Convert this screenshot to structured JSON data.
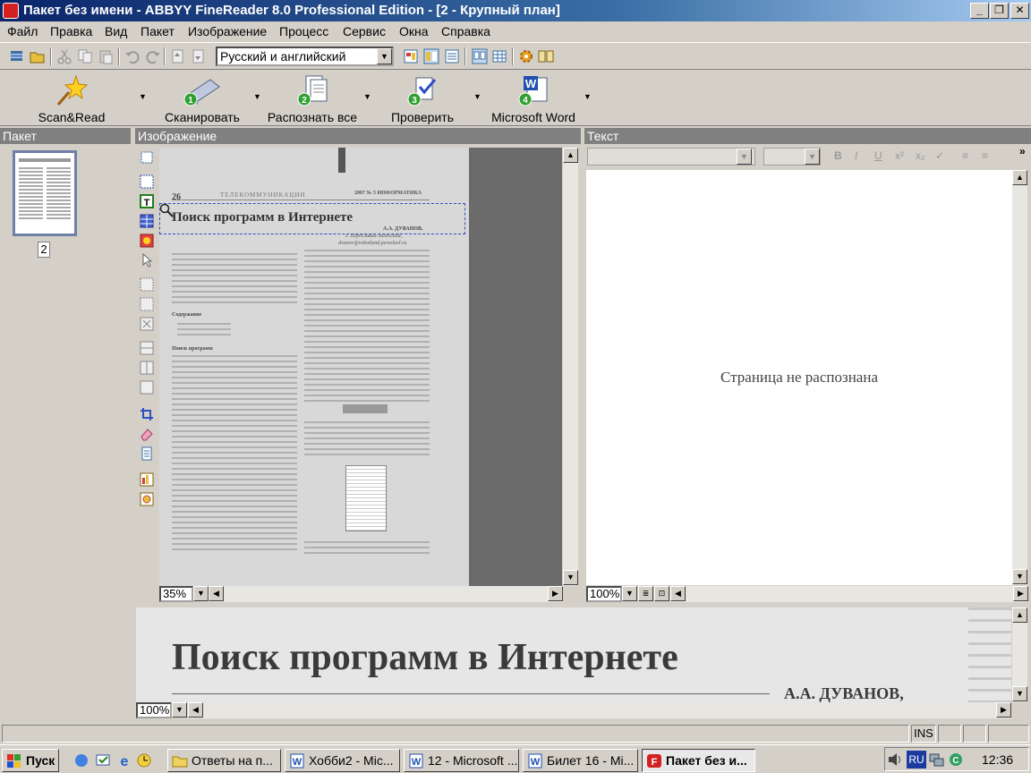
{
  "window": {
    "title": "Пакет без имени - ABBYY FineReader 8.0 Professional Edition - [2 - Крупный план]"
  },
  "menu": [
    "Файл",
    "Правка",
    "Вид",
    "Пакет",
    "Изображение",
    "Процесс",
    "Сервис",
    "Окна",
    "Справка"
  ],
  "toolbar": {
    "language": "Русский и английский"
  },
  "steps": [
    {
      "label": "Scan&Read",
      "icon": "star-wand-icon"
    },
    {
      "label": "Сканировать",
      "icon": "scanner-icon",
      "num": "1"
    },
    {
      "label": "Распознать все",
      "icon": "recognize-icon",
      "num": "2"
    },
    {
      "label": "Проверить",
      "icon": "check-icon",
      "num": "3"
    },
    {
      "label": "Microsoft Word",
      "icon": "word-icon",
      "num": "4"
    }
  ],
  "panels": {
    "batch": "Пакет",
    "image": "Изображение",
    "text": "Текст"
  },
  "batch": {
    "page_number": "2"
  },
  "scan": {
    "page_no": "26",
    "header_center": "ТЕЛЕКОММУНИКАЦИИ",
    "header_right": "2007 № 5 ИНФОРМАТИКА",
    "title": "Поиск программ в Интернете",
    "author": "А.А. ДУВАНОВ,",
    "author_place": "г. Переславль-Залесский,",
    "author_email": "dvanov@robotland.pereslavl.ru",
    "section1": "Содержание",
    "section2": "Поиск программ"
  },
  "image_zoom": "35%",
  "text_zoom": "100%",
  "zoom_zoom": "100%",
  "text_pane": {
    "unrecognized": "Страница не распознана"
  },
  "status": {
    "ins": "INS"
  },
  "taskbar": {
    "start": "Пуск",
    "items": [
      {
        "label": "Ответы на п...",
        "icon": "folder-icon"
      },
      {
        "label": "Хобби2 - Mic...",
        "icon": "word-doc-icon"
      },
      {
        "label": "12 - Microsoft ...",
        "icon": "word-doc-icon"
      },
      {
        "label": "Билет 16 - Mi...",
        "icon": "word-doc-icon"
      },
      {
        "label": "Пакет без и...",
        "icon": "finereader-icon"
      }
    ],
    "lang": "RU",
    "clock": "12:36"
  }
}
